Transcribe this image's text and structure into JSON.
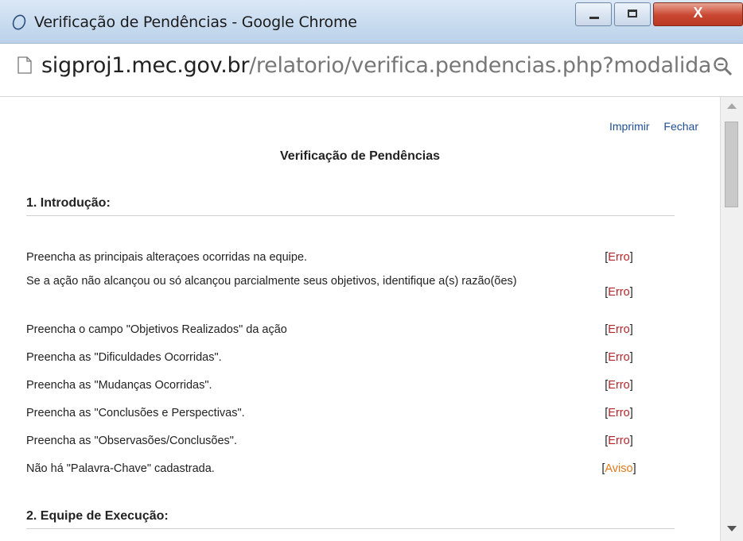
{
  "window": {
    "title": "Verificação de Pendências - Google Chrome",
    "close_glyph": "X"
  },
  "address": {
    "host": "sigproj1.mec.gov.br",
    "path": "/relatorio/verifica.pendencias.php?modalida"
  },
  "toolbar": {
    "print_label": "Imprimir",
    "close_label": "Fechar"
  },
  "page": {
    "title": "Verificação de Pendências"
  },
  "sections": [
    {
      "heading": "1. Introdução:",
      "items": [
        {
          "text": "Preencha as principais alteraçoes ocorridas na equipe.",
          "status": "Erro"
        },
        {
          "text": "Se a ação não alcançou ou só alcançou parcialmente seus objetivos, identifique a(s) razão(ões)",
          "status": "Erro"
        },
        {
          "text": "Preencha o campo \"Objetivos Realizados\" da ação",
          "status": "Erro"
        },
        {
          "text": "Preencha as \"Dificuldades Ocorridas\".",
          "status": "Erro"
        },
        {
          "text": "Preencha as \"Mudanças Ocorridas\".",
          "status": "Erro"
        },
        {
          "text": "Preencha as \"Conclusões e Perspectivas\".",
          "status": "Erro"
        },
        {
          "text": "Preencha as \"Observasões/Conclusões\".",
          "status": "Erro"
        },
        {
          "text": "Não há \"Palavra-Chave\" cadastrada.",
          "status": "Aviso"
        }
      ]
    },
    {
      "heading": "2. Equipe de Execução:"
    }
  ],
  "colors": {
    "error": "#b5262b",
    "warning": "#e07a1a",
    "link": "#1f4f93"
  },
  "icons": {
    "browser": "chrome-app-icon",
    "page": "page-icon",
    "zoom": "zoom-icon"
  }
}
